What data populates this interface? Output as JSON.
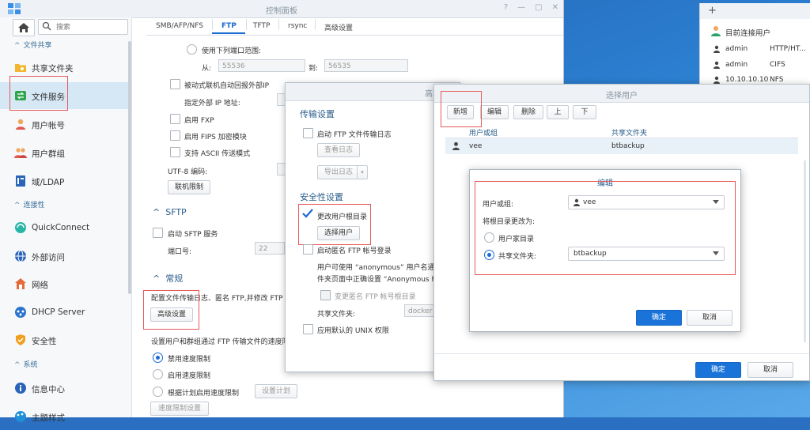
{
  "main_window": {
    "title": "控制面板",
    "search_placeholder": "搜索",
    "sidebar": {
      "sections": {
        "file_sharing": "文件共享",
        "connectivity": "连接性",
        "system": "系统"
      },
      "items": {
        "shared_folder": "共享文件夹",
        "file_services": "文件服务",
        "user": "用户帐号",
        "group": "用户群组",
        "domain": "域/LDAP",
        "quickconnect": "QuickConnect",
        "external_access": "外部访问",
        "network": "网络",
        "dhcp": "DHCP Server",
        "security": "安全性",
        "info_center": "信息中心",
        "theme": "主题样式"
      }
    },
    "tabs": [
      "SMB/AFP/NFS",
      "FTP",
      "TFTP",
      "rsync",
      "高级设置"
    ],
    "ftp": {
      "use_port_range": "使用下列端口范围:",
      "from_label": "从:",
      "from_value": "55536",
      "to_label": "到:",
      "to_value": "56535",
      "passive_report": "被动式联机自动回报外部IP",
      "external_ip": "指定外部 IP 地址:",
      "enable_fxp": "启用 FXP",
      "enable_fips": "启用 FIPS 加密模块",
      "ascii": "支持 ASCII 传送模式",
      "utf8": "UTF-8 编码:",
      "conn_limit": "联机限制",
      "sftp_title": "SFTP",
      "enable_sftp": "启动 SFTP 服务",
      "port_label": "端口号:",
      "port_value": "22",
      "general_title": "常规",
      "general_desc": "配置文件传输日志、匿名 FTP,并修改 FTP 的",
      "advanced_btn": "高级设置",
      "speed_desc": "设置用户和群组通过 FTP 传输文件的速度限制",
      "speed_opts": [
        "禁用速度限制",
        "启用速度限制",
        "根据计划启用速度限制"
      ],
      "schedule_btn": "设置计划",
      "speed_settings_btn": "速度限制设置"
    }
  },
  "connection_panel": {
    "add": "+",
    "title": "目前连接用户",
    "rows": [
      {
        "user": "admin",
        "proto": "HTTP/HT..."
      },
      {
        "user": "admin",
        "proto": "CIFS"
      },
      {
        "user": "10.10.10.10",
        "proto": "NFS"
      }
    ]
  },
  "advanced_dialog": {
    "title": "高",
    "transfer_title": "传输设置",
    "enable_log": "启动 FTP 文件传输日志",
    "view_log": "查看日志",
    "export_log": "导出日志",
    "security_title": "安全性设置",
    "change_root": "更改用户根目录",
    "select_user": "选择用户",
    "enable_anon": "启动匿名 FTP 帐号登录",
    "anon_desc_1": "用户可使用 “anonymous” 用户名通过",
    "anon_desc_2": "件夹页面中正确设置 “Anonymous FT",
    "change_anon_root": "变更匿名 FTP 帐号根目录",
    "shared_folder_label": "共享文件夹:",
    "shared_folder_value": "docker",
    "apply_umask": "应用默认的 UNIX 权限"
  },
  "select_user_dialog": {
    "title": "选择用户",
    "toolbar": [
      "新增",
      "编辑",
      "删除",
      "上",
      "下"
    ],
    "col_user": "用户或组",
    "col_folder": "共享文件夹",
    "rows": [
      {
        "user": "vee",
        "folder": "btbackup"
      }
    ],
    "ok": "确定",
    "cancel": "取消"
  },
  "edit_dialog": {
    "title": "编辑",
    "user_label": "用户或组:",
    "user_value": "vee",
    "change_root_label": "将根目录更改为:",
    "opt_home": "用户家目录",
    "opt_shared": "共享文件夹:",
    "shared_value": "btbackup",
    "ok": "确定",
    "cancel": "取消"
  }
}
